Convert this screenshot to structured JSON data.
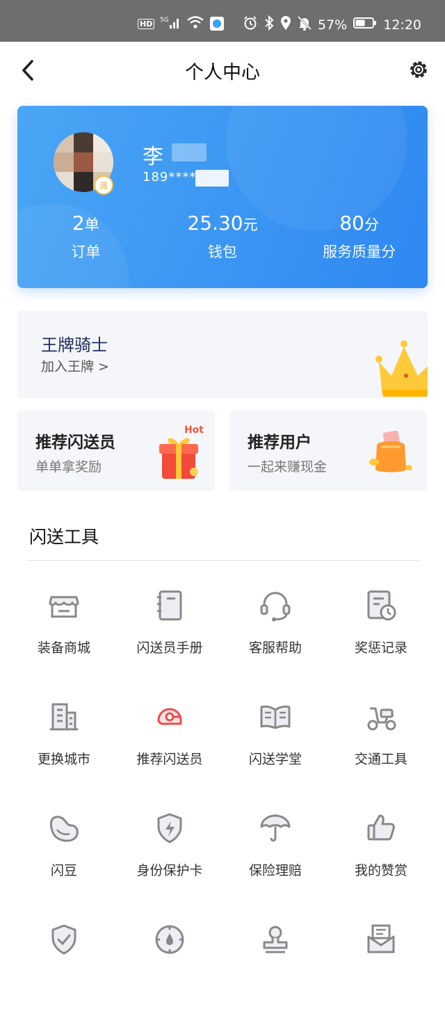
{
  "status_bar": {
    "left_icons": [
      "hd-icon",
      "5g-signal-icon",
      "wifi-icon",
      "app-notification-icon"
    ],
    "right_icons": [
      "alarm-icon",
      "bluetooth-icon",
      "location-icon",
      "mute-icon"
    ],
    "battery": "57%",
    "battery_level": 0.57,
    "time": "12:20"
  },
  "header": {
    "title": "个人中心",
    "back_icon": "chevron-left-icon",
    "settings_icon": "gear-icon"
  },
  "profile": {
    "name": "李",
    "phone": "189****",
    "badge": "派",
    "colors": {
      "start": "#4aa6f4",
      "end": "#2e88f2"
    },
    "stats": [
      {
        "value": "2",
        "unit": "单",
        "label": "订单"
      },
      {
        "value": "25.30",
        "unit": "元",
        "label": "钱包"
      },
      {
        "value": "80",
        "unit": "分",
        "label": "服务质量分"
      }
    ]
  },
  "ace_knight": {
    "title": "王牌骑士",
    "subtitle": "加入王牌 >",
    "icon": "crown-icon"
  },
  "referrals": [
    {
      "title": "推荐闪送员",
      "subtitle": "单单拿奖励",
      "icon": "gift-box-icon",
      "tag": "Hot"
    },
    {
      "title": "推荐用户",
      "subtitle": "一起来赚现金",
      "icon": "money-bag-icon"
    }
  ],
  "tools": {
    "title": "闪送工具",
    "items": [
      {
        "label": "装备商城",
        "icon": "store-icon"
      },
      {
        "label": "闪送员手册",
        "icon": "handbook-icon"
      },
      {
        "label": "客服帮助",
        "icon": "headset-icon"
      },
      {
        "label": "奖惩记录",
        "icon": "record-clock-icon"
      },
      {
        "label": "更换城市",
        "icon": "buildings-icon"
      },
      {
        "label": "推荐闪送员",
        "icon": "helmet-icon"
      },
      {
        "label": "闪送学堂",
        "icon": "book-icon"
      },
      {
        "label": "交通工具",
        "icon": "scooter-icon"
      },
      {
        "label": "闪豆",
        "icon": "bean-icon"
      },
      {
        "label": "身份保护卡",
        "icon": "shield-bolt-icon"
      },
      {
        "label": "保险理赔",
        "icon": "umbrella-icon"
      },
      {
        "label": "我的赞赏",
        "icon": "thumbs-up-icon"
      },
      {
        "label": "",
        "icon": "shield-check-icon"
      },
      {
        "label": "",
        "icon": "gauge-drop-icon"
      },
      {
        "label": "",
        "icon": "stamp-icon"
      },
      {
        "label": "",
        "icon": "mailbox-icon"
      }
    ]
  }
}
